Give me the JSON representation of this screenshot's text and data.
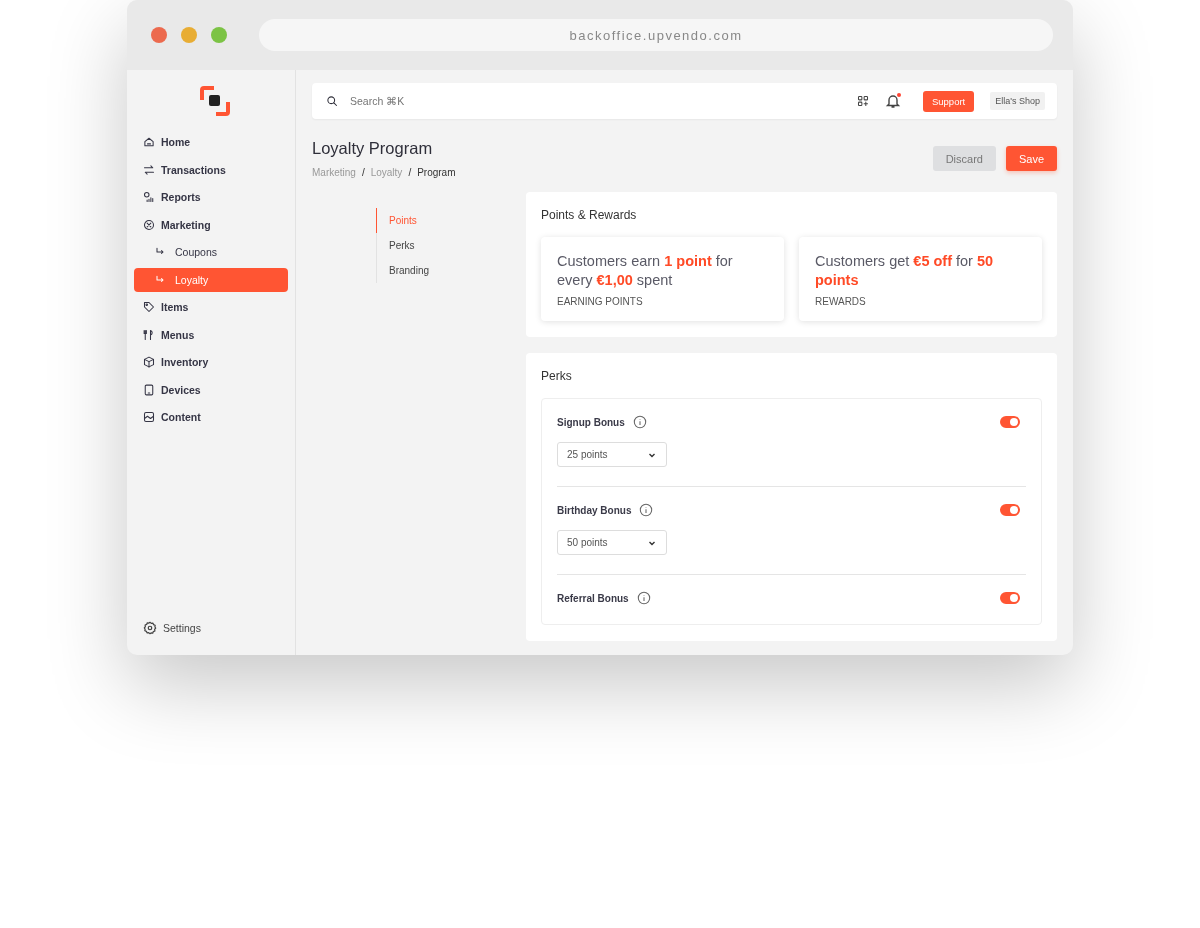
{
  "browser": {
    "url": "backoffice.upvendo.com"
  },
  "sidebar": {
    "items": [
      {
        "label": "Home",
        "kind": "item",
        "selected": false
      },
      {
        "label": "Transactions",
        "kind": "item",
        "selected": false
      },
      {
        "label": "Reports",
        "kind": "item",
        "selected": false
      },
      {
        "label": "Marketing",
        "kind": "item",
        "selected": false
      },
      {
        "label": "Coupons",
        "kind": "sub",
        "selected": false
      },
      {
        "label": "Loyalty",
        "kind": "sub",
        "selected": true
      },
      {
        "label": "Items",
        "kind": "item",
        "selected": false
      },
      {
        "label": "Menus",
        "kind": "item",
        "selected": false
      },
      {
        "label": "Inventory",
        "kind": "item",
        "selected": false
      },
      {
        "label": "Devices",
        "kind": "item",
        "selected": false
      },
      {
        "label": "Content",
        "kind": "item",
        "selected": false
      }
    ],
    "footer": {
      "label": "Settings"
    }
  },
  "topbar": {
    "search": {
      "placeholder": "Search ⌘K"
    },
    "notification_dot": true,
    "support_button": "Support",
    "shop": "Ella's Shop"
  },
  "page": {
    "title": "Loyalty Program",
    "breadcrumb": [
      {
        "kind": "link",
        "text": "Marketing"
      },
      {
        "kind": "separator",
        "text": "/"
      },
      {
        "kind": "link",
        "text": "Loyalty"
      },
      {
        "kind": "separator",
        "text": "/"
      },
      {
        "kind": "current",
        "text": "Program"
      }
    ],
    "buttons": {
      "discard": "Discard",
      "save": "Save"
    }
  },
  "subnav": [
    {
      "label": "Points",
      "selected": true
    },
    {
      "label": "Perks",
      "selected": false
    },
    {
      "label": "Branding",
      "selected": false
    }
  ],
  "points_rewards": {
    "title": "Points & Rewards",
    "cards": [
      {
        "text": "Customers earn **1 point** for every **€1,00** spent",
        "caption": "EARNING POINTS"
      },
      {
        "text": "Customers get **€5 off** for **50 points**",
        "caption": "REWARDS"
      }
    ]
  },
  "perks": {
    "title": "Perks",
    "items": [
      {
        "label": "Signup Bonus",
        "on": true,
        "value": "25 points"
      },
      {
        "label": "Birthday Bonus",
        "on": true,
        "value": "50 points"
      },
      {
        "label": "Referral Bonus",
        "on": true
      }
    ]
  }
}
